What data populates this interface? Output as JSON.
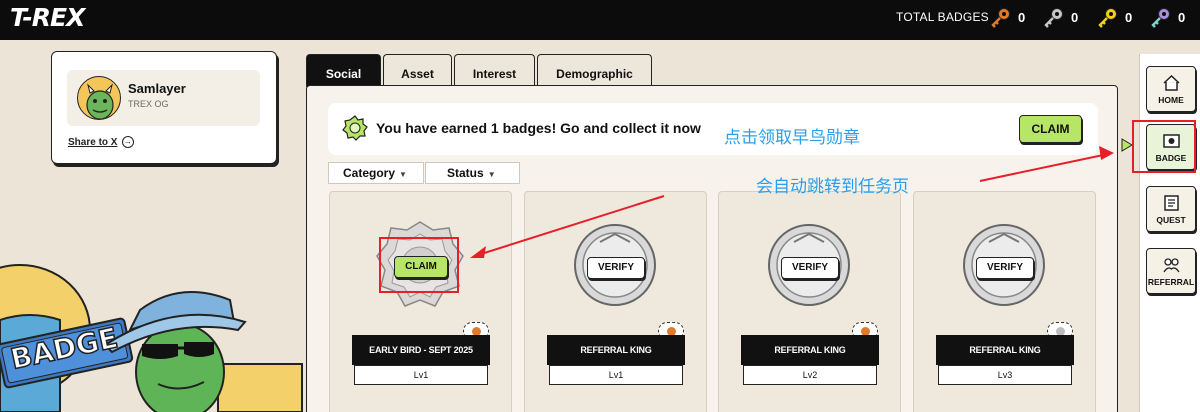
{
  "header": {
    "logo": "T-REX",
    "total_badges_label": "TOTAL BADGES",
    "keys": [
      {
        "icon": "bronze-key-icon",
        "color": "#e07b2a",
        "count": "0"
      },
      {
        "icon": "silver-key-icon",
        "color": "#c8c8c8",
        "count": "0"
      },
      {
        "icon": "gold-key-icon",
        "color": "#f1d219",
        "count": "0"
      },
      {
        "icon": "rainbow-key-icon",
        "color": "#a88fe0",
        "count": "0"
      }
    ]
  },
  "profile": {
    "name": "Samlayer",
    "subtitle": "TREX OG",
    "share_label": "Share to X"
  },
  "tabs": [
    {
      "label": "Social",
      "active": true
    },
    {
      "label": "Asset",
      "active": false
    },
    {
      "label": "Interest",
      "active": false
    },
    {
      "label": "Demographic",
      "active": false
    }
  ],
  "earned": {
    "message": "You have earned 1 badges! Go and collect it now",
    "claim_label": "CLAIM"
  },
  "filters": {
    "category": "Category",
    "status": "Status"
  },
  "badges": [
    {
      "action": "CLAIM",
      "name": "EARLY BIRD - SEPT 2025",
      "level": "Lv1",
      "tag_color": "#e07b2a"
    },
    {
      "action": "VERIFY",
      "name": "REFERRAL KING",
      "level": "Lv1",
      "tag_color": "#e07b2a"
    },
    {
      "action": "VERIFY",
      "name": "REFERRAL KING",
      "level": "Lv2",
      "tag_color": "#e07b2a"
    },
    {
      "action": "VERIFY",
      "name": "REFERRAL KING",
      "level": "Lv3",
      "tag_color": "#bdbdbd"
    }
  ],
  "nav": [
    {
      "label": "HOME",
      "icon": "home-icon"
    },
    {
      "label": "BADGE",
      "icon": "badge-icon"
    },
    {
      "label": "QUEST",
      "icon": "quest-icon"
    },
    {
      "label": "REFERRAL",
      "icon": "referral-icon"
    }
  ],
  "annotations": {
    "click_claim": "点击领取早鸟勋章",
    "auto_jump": "会自动跳转到任务页"
  },
  "illustration": {
    "sign_text": "BADGE"
  },
  "colors": {
    "accent_green": "#b7e667",
    "annotation_red": "#e5202a",
    "annotation_blue": "#2a9ee9"
  }
}
